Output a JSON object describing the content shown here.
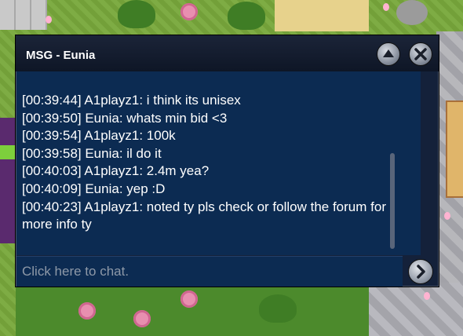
{
  "window": {
    "title": "MSG - Eunia",
    "minimize_icon": "chevron-up-icon",
    "close_icon": "close-icon"
  },
  "messages": [
    "[00:39:44] A1playz1: i think its unisex",
    "[00:39:50] Eunia: whats min bid <3",
    "[00:39:54] A1playz1: 100k",
    "[00:39:58] Eunia: il do it",
    "[00:40:03] A1playz1: 2.4m yea?",
    "[00:40:09] Eunia: yep :D",
    "[00:40:23] A1playz1: noted ty pls check or follow the forum for more info ty"
  ],
  "chat_input": {
    "placeholder": "Click here to chat.",
    "send_icon": "arrow-right-icon"
  },
  "colors": {
    "window_bg": "#0c2b52",
    "titlebar": "#141d2f",
    "text": "#ffffff",
    "placeholder": "#8e99a8"
  }
}
